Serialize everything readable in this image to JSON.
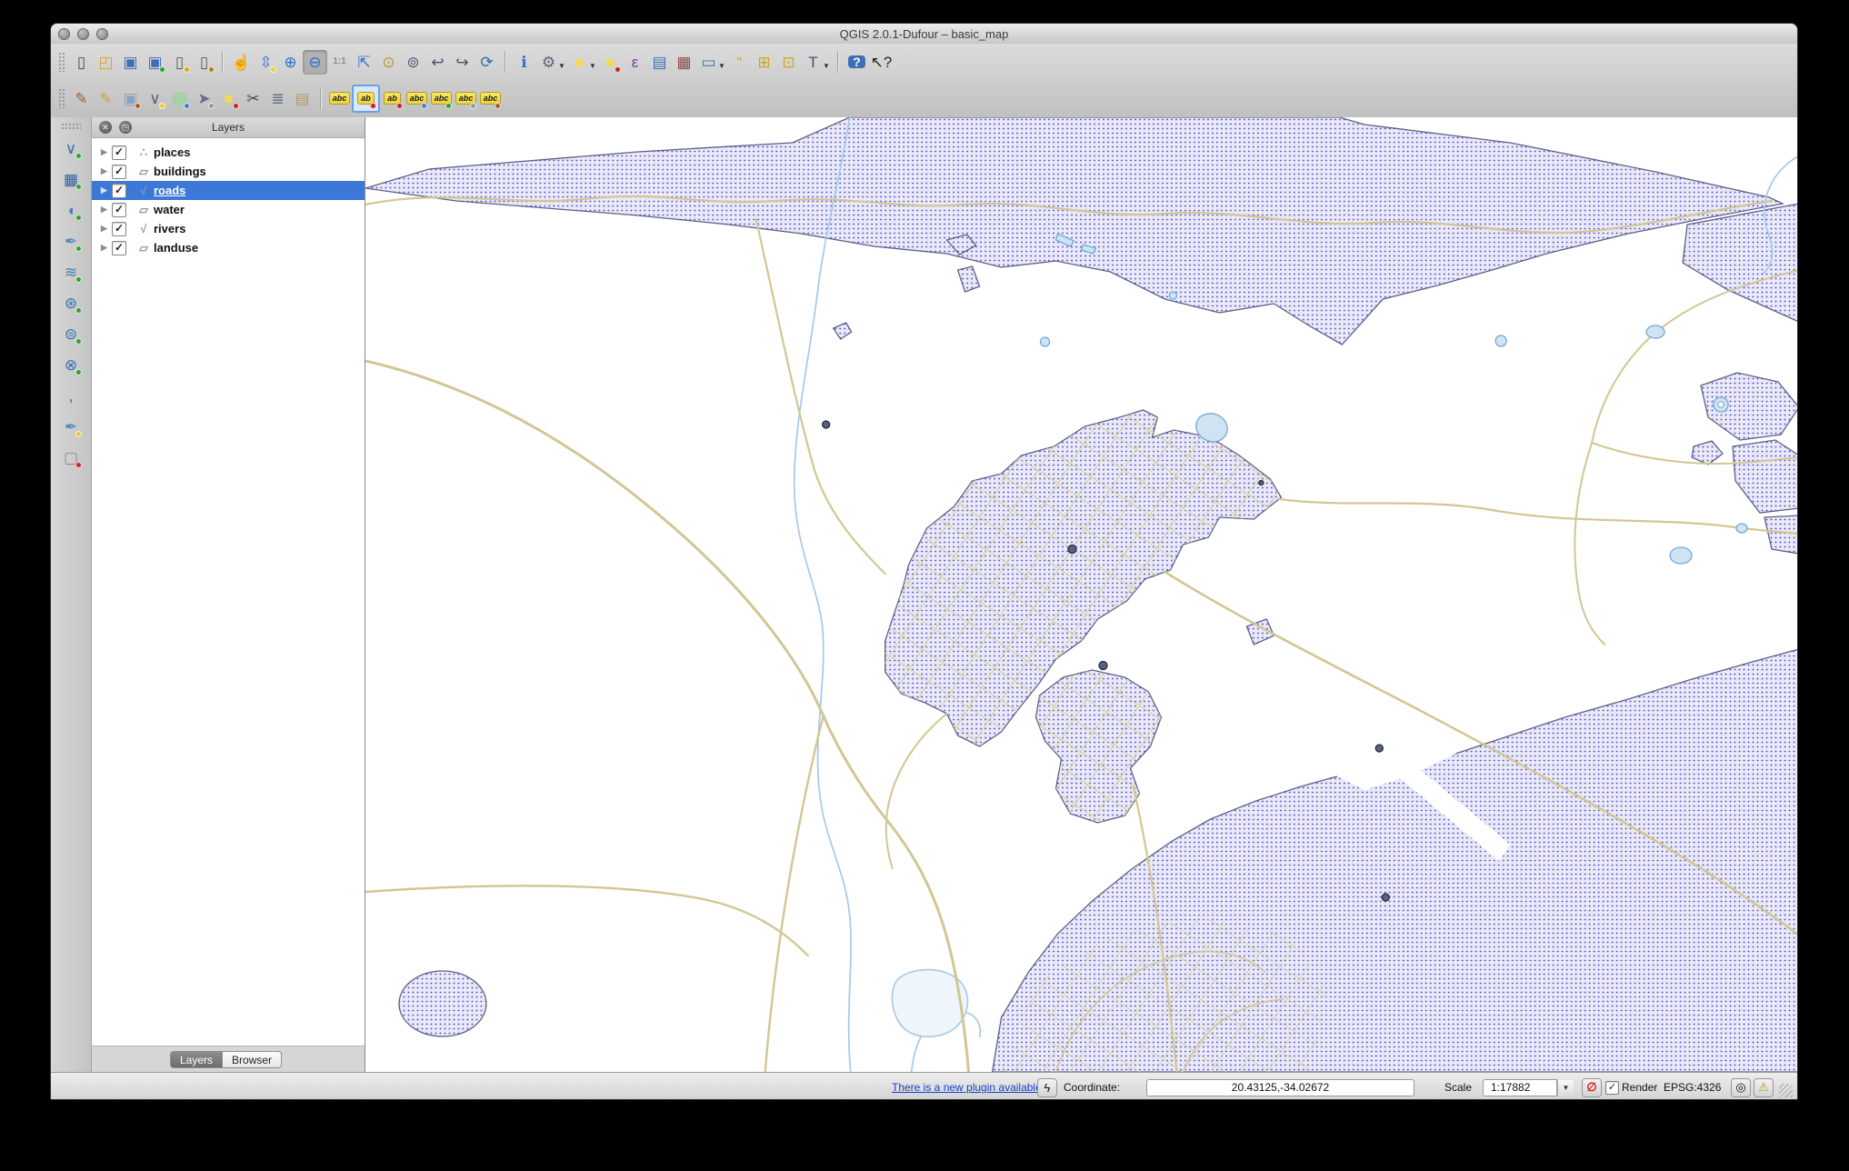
{
  "window": {
    "title": "QGIS 2.0.1-Dufour – basic_map"
  },
  "colors": {
    "landuse_fill": "#e9e9f7",
    "landuse_dot": "#3c3ccb",
    "landuse_border": "#5f5f88",
    "road": "#d2c694",
    "road_light": "#dcd3ab",
    "river": "#a5c9e8",
    "water_fill": "#cfe3f3",
    "water_border": "#74a9d4",
    "place_fill": "#58627f",
    "place_border": "#23293f",
    "selection": "#3c78d8"
  },
  "toolbar_main": {
    "items": [
      {
        "h": true
      },
      {
        "n": "new-project",
        "g": "▯",
        "c": "#4a4a4a"
      },
      {
        "n": "open-project",
        "g": "◰",
        "c": "#d9a521"
      },
      {
        "n": "save-project",
        "g": "▣",
        "c": "#3f6fb5"
      },
      {
        "n": "save-project-as",
        "g": "▣",
        "c": "#3f6fb5",
        "b": "#2da52d"
      },
      {
        "n": "new-print-composer",
        "g": "▯",
        "c": "#5a5a5a",
        "b": "#d9a521"
      },
      {
        "n": "composer-manager",
        "g": "▯",
        "c": "#5a5a5a",
        "b": "#b07c2a"
      },
      {
        "s": true
      },
      {
        "n": "pan-map",
        "g": "☝",
        "c": "#2b2b2b"
      },
      {
        "n": "pan-to-selection",
        "g": "⇳",
        "c": "#2f6fd0",
        "b": "#e8cc3a"
      },
      {
        "n": "zoom-in",
        "g": "⊕",
        "c": "#2f6fd0"
      },
      {
        "n": "zoom-out",
        "g": "⊖",
        "c": "#2f6fd0",
        "active": true
      },
      {
        "n": "zoom-native",
        "g": "1:1",
        "c": "#8a8a8a",
        "small": true
      },
      {
        "n": "zoom-full",
        "g": "⇱",
        "c": "#2f6fd0"
      },
      {
        "n": "zoom-to-selection",
        "g": "⊙",
        "c": "#b09a2a"
      },
      {
        "n": "zoom-to-layer",
        "g": "⊚",
        "c": "#55607a"
      },
      {
        "n": "zoom-last",
        "g": "↩",
        "c": "#45506a"
      },
      {
        "n": "zoom-next",
        "g": "↪",
        "c": "#45506a"
      },
      {
        "n": "refresh-map",
        "g": "⟳",
        "c": "#2f6fb0"
      },
      {
        "s": true
      },
      {
        "n": "identify-features",
        "g": "ℹ",
        "c": "#2f6fd0"
      },
      {
        "n": "run-feature-action",
        "g": "⚙",
        "c": "#5a6275",
        "dd": true
      },
      {
        "n": "select-features",
        "g": "■",
        "c": "#f0d95c",
        "dd": true
      },
      {
        "n": "deselect-features",
        "g": "■",
        "c": "#f0d95c",
        "b": "#cc2222"
      },
      {
        "n": "select-by-expression",
        "g": "ε",
        "c": "#7a3fa0"
      },
      {
        "n": "open-attribute-table",
        "g": "▤",
        "c": "#3f6fb5"
      },
      {
        "n": "field-calculator",
        "g": "▦",
        "c": "#8a4a4a"
      },
      {
        "n": "measure",
        "g": "▭",
        "c": "#476b9e",
        "dd": true
      },
      {
        "n": "map-tips",
        "g": "“",
        "c": "#c9a820"
      },
      {
        "n": "new-bookmark",
        "g": "⊞",
        "c": "#c9a820"
      },
      {
        "n": "show-bookmarks",
        "g": "⊡",
        "c": "#c9a820"
      },
      {
        "n": "text-annotation",
        "g": "T",
        "c": "#44506a",
        "dd": true
      },
      {
        "s": true
      },
      {
        "n": "help-contents",
        "g": "?",
        "c": "#ffffff",
        "bg": "#3f6fb5"
      },
      {
        "n": "whats-this",
        "g": "↖?",
        "c": "#222222"
      }
    ]
  },
  "toolbar_edit": {
    "items": [
      {
        "h": true
      },
      {
        "n": "current-edits",
        "g": "✎",
        "c": "#b05a2a"
      },
      {
        "n": "toggle-editing",
        "g": "✎",
        "c": "#c8a92f"
      },
      {
        "n": "save-layer-edits",
        "g": "▣",
        "c": "#8aa0c0",
        "b": "#b05a2a"
      },
      {
        "n": "add-feature",
        "g": "∨",
        "c": "#55607a",
        "b": "#e8cc3a"
      },
      {
        "n": "move-feature",
        "g": "⬤",
        "c": "#a9cfa9",
        "b": "#4a7fd0"
      },
      {
        "n": "node-tool",
        "g": "➤",
        "c": "#667088",
        "b": "#9a9a9a"
      },
      {
        "n": "delete-selected",
        "g": "■",
        "c": "#f0d95c",
        "b": "#cc2222"
      },
      {
        "n": "cut-features",
        "g": "✂",
        "c": "#4a4a4a"
      },
      {
        "n": "copy-features",
        "g": "≣",
        "c": "#667088"
      },
      {
        "n": "paste-features",
        "g": "▤",
        "c": "#b59a6a"
      },
      {
        "s": true
      },
      {
        "n": "layer-labeling-options",
        "g": "abc",
        "tag": true
      },
      {
        "n": "pin-unpin-labels",
        "g": "ab",
        "tag": true,
        "b": "#cc2222",
        "active": true
      },
      {
        "n": "highlight-pinned-labels",
        "g": "ab",
        "tag": true,
        "b": "#cc2222"
      },
      {
        "n": "move-label",
        "g": "abc",
        "tag": true,
        "b": "#4a7fd0"
      },
      {
        "n": "rotate-label",
        "g": "abc",
        "tag": true,
        "b": "#2f9e2f"
      },
      {
        "n": "change-label",
        "g": "abc",
        "tag": true,
        "b": "#9a9a9a"
      },
      {
        "n": "label-properties",
        "g": "abc",
        "tag": true,
        "b": "#b05a2a"
      }
    ]
  },
  "toolbar_layers": {
    "items": [
      {
        "n": "add-vector-layer",
        "g": "∨",
        "c": "#3a6fae",
        "b": "#2da52d"
      },
      {
        "n": "add-raster-layer",
        "g": "▦",
        "c": "#2f5f9e",
        "b": "#2da52d"
      },
      {
        "n": "add-postgis-layer",
        "g": "◖",
        "c": "#4a7fb5",
        "b": "#2da52d"
      },
      {
        "n": "add-spatialite-layer",
        "g": "✒",
        "c": "#5a8ac0",
        "b": "#2da52d"
      },
      {
        "n": "add-mssql-layer",
        "g": "≋",
        "c": "#4a7fb5",
        "b": "#2da52d"
      },
      {
        "n": "add-wms-layer",
        "g": "⊛",
        "c": "#3a6fae",
        "b": "#2da52d"
      },
      {
        "n": "add-wcs-layer",
        "g": "⊜",
        "c": "#3a6fae",
        "b": "#2da52d"
      },
      {
        "n": "add-wfs-layer",
        "g": "⊗",
        "c": "#3a6fae",
        "b": "#2da52d"
      },
      {
        "n": "add-delimited-text-layer",
        "g": ",",
        "c": "#2f5f9e"
      },
      {
        "n": "new-spatialite-layer",
        "g": "✒",
        "c": "#5a8ac0",
        "b": "#e8cc3a"
      },
      {
        "n": "new-shapefile-layer",
        "g": "▢",
        "c": "#8a8a8a",
        "b": "#cc2222"
      }
    ]
  },
  "layers_panel": {
    "title": "Layers",
    "close_glyph": "✕",
    "float_glyph": "◳",
    "layers": [
      {
        "name": "places",
        "type": "point",
        "checked": true,
        "selected": false
      },
      {
        "name": "buildings",
        "type": "polygon",
        "checked": true,
        "selected": false
      },
      {
        "name": "roads",
        "type": "line",
        "checked": true,
        "selected": true
      },
      {
        "name": "water",
        "type": "polygon",
        "checked": true,
        "selected": false
      },
      {
        "name": "rivers",
        "type": "line",
        "checked": true,
        "selected": false
      },
      {
        "name": "landuse",
        "type": "polygon",
        "checked": true,
        "selected": false
      }
    ],
    "tabs": [
      {
        "label": "Layers",
        "active": true
      },
      {
        "label": "Browser",
        "active": false
      }
    ]
  },
  "statusbar": {
    "plugin_link": "There is a new plugin available",
    "coordinate_label": "Coordinate:",
    "coordinate_value": "20.43125,-34.02672",
    "scale_label": "Scale",
    "scale_value": "1:17882",
    "render_label": "Render",
    "render_checked": true,
    "crs_text": "EPSG:4326"
  }
}
